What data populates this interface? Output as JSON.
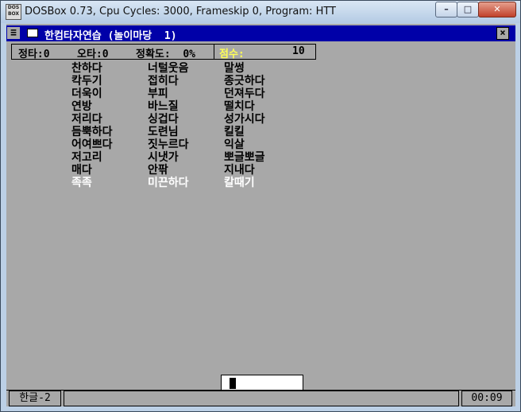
{
  "window": {
    "title": "DOSBox 0.73, Cpu Cycles:     3000, Frameskip  0, Program:       HTT",
    "icon_text": "DOS BOX",
    "minimize_glyph": "–",
    "maximize_glyph": "□",
    "close_glyph": "✕"
  },
  "app": {
    "title": "한컴타자연습 (놀이마당  1)",
    "close_glyph": "×",
    "sys_glyph": "≡"
  },
  "status": {
    "correct": "정타:0",
    "wrong": "오타:0",
    "accuracy": "정확도:  0%",
    "score_label": "점수:",
    "score_value": "10"
  },
  "words": {
    "col1": [
      "찬하다",
      "칵두기",
      "더욱이",
      "연방",
      "저리다",
      "듬뿍하다",
      "어여쁘다",
      "저고리",
      "매다",
      "족족"
    ],
    "col2": [
      "너털웃음",
      "접히다",
      "부피",
      "바느질",
      "싱겁다",
      "도련님",
      "짓누르다",
      "시냇가",
      "안팎",
      "미끈하다"
    ],
    "col3": [
      "말썽",
      "종긋하다",
      "던져두다",
      "떨치다",
      "성가시다",
      "킬킬",
      "익살",
      "뽀글뽀글",
      "지내다",
      "칼때기"
    ]
  },
  "bottom": {
    "mode": "한글-2",
    "timer": "00:09"
  },
  "colors": {
    "dos_blue": "#0000a8",
    "dos_gray": "#a8a8a8",
    "highlight_yellow": "#ffff55"
  }
}
